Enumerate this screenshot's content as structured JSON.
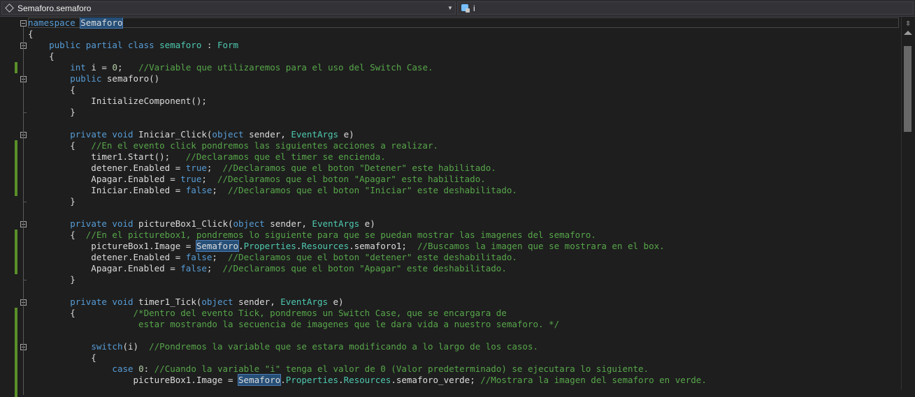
{
  "navbar": {
    "left_text": "Semaforo.semaforo",
    "right_text": "i",
    "left_icon": "class-icon",
    "right_icon": "member-icon"
  },
  "colors": {
    "keyword": "#569cd6",
    "type": "#4ec9b0",
    "comment": "#57a64a",
    "number": "#b5cea8",
    "text": "#dcdcdc",
    "background": "#1e1e1e",
    "highlight": "#264f78",
    "change_bar": "#5a8f29"
  },
  "code": [
    [
      [
        "kw",
        "namespace"
      ],
      [
        "t",
        " "
      ],
      [
        "hl",
        "Semaforo"
      ]
    ],
    [
      [
        "t",
        "{"
      ]
    ],
    [
      [
        "t",
        "    "
      ],
      [
        "kw",
        "public partial class"
      ],
      [
        "t",
        " "
      ],
      [
        "ty",
        "semaforo"
      ],
      [
        "t",
        " : "
      ],
      [
        "ty",
        "Form"
      ]
    ],
    [
      [
        "t",
        "    {"
      ]
    ],
    [
      [
        "t",
        "        "
      ],
      [
        "kw",
        "int"
      ],
      [
        "t",
        " i = "
      ],
      [
        "nm",
        "0"
      ],
      [
        "t",
        ";   "
      ],
      [
        "cm",
        "//Variable que utilizaremos para el uso del Switch Case."
      ]
    ],
    [
      [
        "t",
        "        "
      ],
      [
        "kw",
        "public"
      ],
      [
        "t",
        " semaforo()"
      ]
    ],
    [
      [
        "t",
        "        {"
      ]
    ],
    [
      [
        "t",
        "            InitializeComponent();"
      ]
    ],
    [
      [
        "t",
        "        }"
      ]
    ],
    [
      [
        "t",
        ""
      ]
    ],
    [
      [
        "t",
        "        "
      ],
      [
        "kw",
        "private void"
      ],
      [
        "t",
        " Iniciar_Click("
      ],
      [
        "kw",
        "object"
      ],
      [
        "t",
        " sender, "
      ],
      [
        "ty",
        "EventArgs"
      ],
      [
        "t",
        " e)"
      ]
    ],
    [
      [
        "t",
        "        {   "
      ],
      [
        "cm",
        "//En el evento click pondremos las siguientes acciones a realizar."
      ]
    ],
    [
      [
        "t",
        "            timer1.Start();   "
      ],
      [
        "cm",
        "//Declaramos que el timer se encienda."
      ]
    ],
    [
      [
        "t",
        "            detener.Enabled = "
      ],
      [
        "kw",
        "true"
      ],
      [
        "t",
        ";  "
      ],
      [
        "cm",
        "//Declaramos que el boton \"Detener\" este habilitado."
      ]
    ],
    [
      [
        "t",
        "            Apagar.Enabled = "
      ],
      [
        "kw",
        "true"
      ],
      [
        "t",
        ";  "
      ],
      [
        "cm",
        "//Declaramos que el boton \"Apagar\" este habilitado."
      ]
    ],
    [
      [
        "t",
        "            Iniciar.Enabled = "
      ],
      [
        "kw",
        "false"
      ],
      [
        "t",
        ";  "
      ],
      [
        "cm",
        "//Declaramos que el boton \"Iniciar\" este deshabilitado."
      ]
    ],
    [
      [
        "t",
        "        }"
      ]
    ],
    [
      [
        "t",
        ""
      ]
    ],
    [
      [
        "t",
        "        "
      ],
      [
        "kw",
        "private void"
      ],
      [
        "t",
        " pictureBox1_Click("
      ],
      [
        "kw",
        "object"
      ],
      [
        "t",
        " sender, "
      ],
      [
        "ty",
        "EventArgs"
      ],
      [
        "t",
        " e)"
      ]
    ],
    [
      [
        "t",
        "        {  "
      ],
      [
        "cm",
        "//En el picturebox1, pondremos lo siguiente para que se puedan mostrar las imagenes del semaforo."
      ]
    ],
    [
      [
        "t",
        "            pictureBox1.Image = "
      ],
      [
        "hl",
        "Semaforo"
      ],
      [
        "t",
        "."
      ],
      [
        "ty",
        "Properties"
      ],
      [
        "t",
        "."
      ],
      [
        "ty",
        "Resources"
      ],
      [
        "t",
        ".semaforo1;  "
      ],
      [
        "cm",
        "//Buscamos la imagen que se mostrara en el box."
      ]
    ],
    [
      [
        "t",
        "            detener.Enabled = "
      ],
      [
        "kw",
        "false"
      ],
      [
        "t",
        ";  "
      ],
      [
        "cm",
        "//Declaramos que el boton \"detener\" este deshabilitado."
      ]
    ],
    [
      [
        "t",
        "            Apagar.Enabled = "
      ],
      [
        "kw",
        "false"
      ],
      [
        "t",
        ";  "
      ],
      [
        "cm",
        "//Declaramos que el boton \"Apagar\" este deshabilitado."
      ]
    ],
    [
      [
        "t",
        "        }"
      ]
    ],
    [
      [
        "t",
        ""
      ]
    ],
    [
      [
        "t",
        "        "
      ],
      [
        "kw",
        "private void"
      ],
      [
        "t",
        " timer1_Tick("
      ],
      [
        "kw",
        "object"
      ],
      [
        "t",
        " sender, "
      ],
      [
        "ty",
        "EventArgs"
      ],
      [
        "t",
        " e)"
      ]
    ],
    [
      [
        "t",
        "        {           "
      ],
      [
        "cm",
        "/*Dentro del evento Tick, pondremos un Switch Case, que se encargara de"
      ]
    ],
    [
      [
        "cm",
        "                     estar mostrando la secuencia de imagenes que le dara vida a nuestro semaforo. */"
      ]
    ],
    [
      [
        "t",
        ""
      ]
    ],
    [
      [
        "t",
        "            "
      ],
      [
        "kw",
        "switch"
      ],
      [
        "t",
        "(i)  "
      ],
      [
        "cm",
        "//Pondremos la variable que se estara modificando a lo largo de los casos."
      ]
    ],
    [
      [
        "t",
        "            {"
      ]
    ],
    [
      [
        "t",
        "                "
      ],
      [
        "kw",
        "case"
      ],
      [
        "t",
        " "
      ],
      [
        "nm",
        "0"
      ],
      [
        "t",
        ": "
      ],
      [
        "cm",
        "//Cuando la variable \"i\" tenga el valor de 0 (Valor predeterminado) se ejecutara lo siguiente."
      ]
    ],
    [
      [
        "t",
        "                    pictureBox1.Image = "
      ],
      [
        "hl",
        "Semaforo"
      ],
      [
        "t",
        "."
      ],
      [
        "ty",
        "Properties"
      ],
      [
        "t",
        "."
      ],
      [
        "ty",
        "Resources"
      ],
      [
        "t",
        ".semaforo_verde; "
      ],
      [
        "cm",
        "//Mostrara la imagen del semaforo en verde."
      ]
    ]
  ]
}
